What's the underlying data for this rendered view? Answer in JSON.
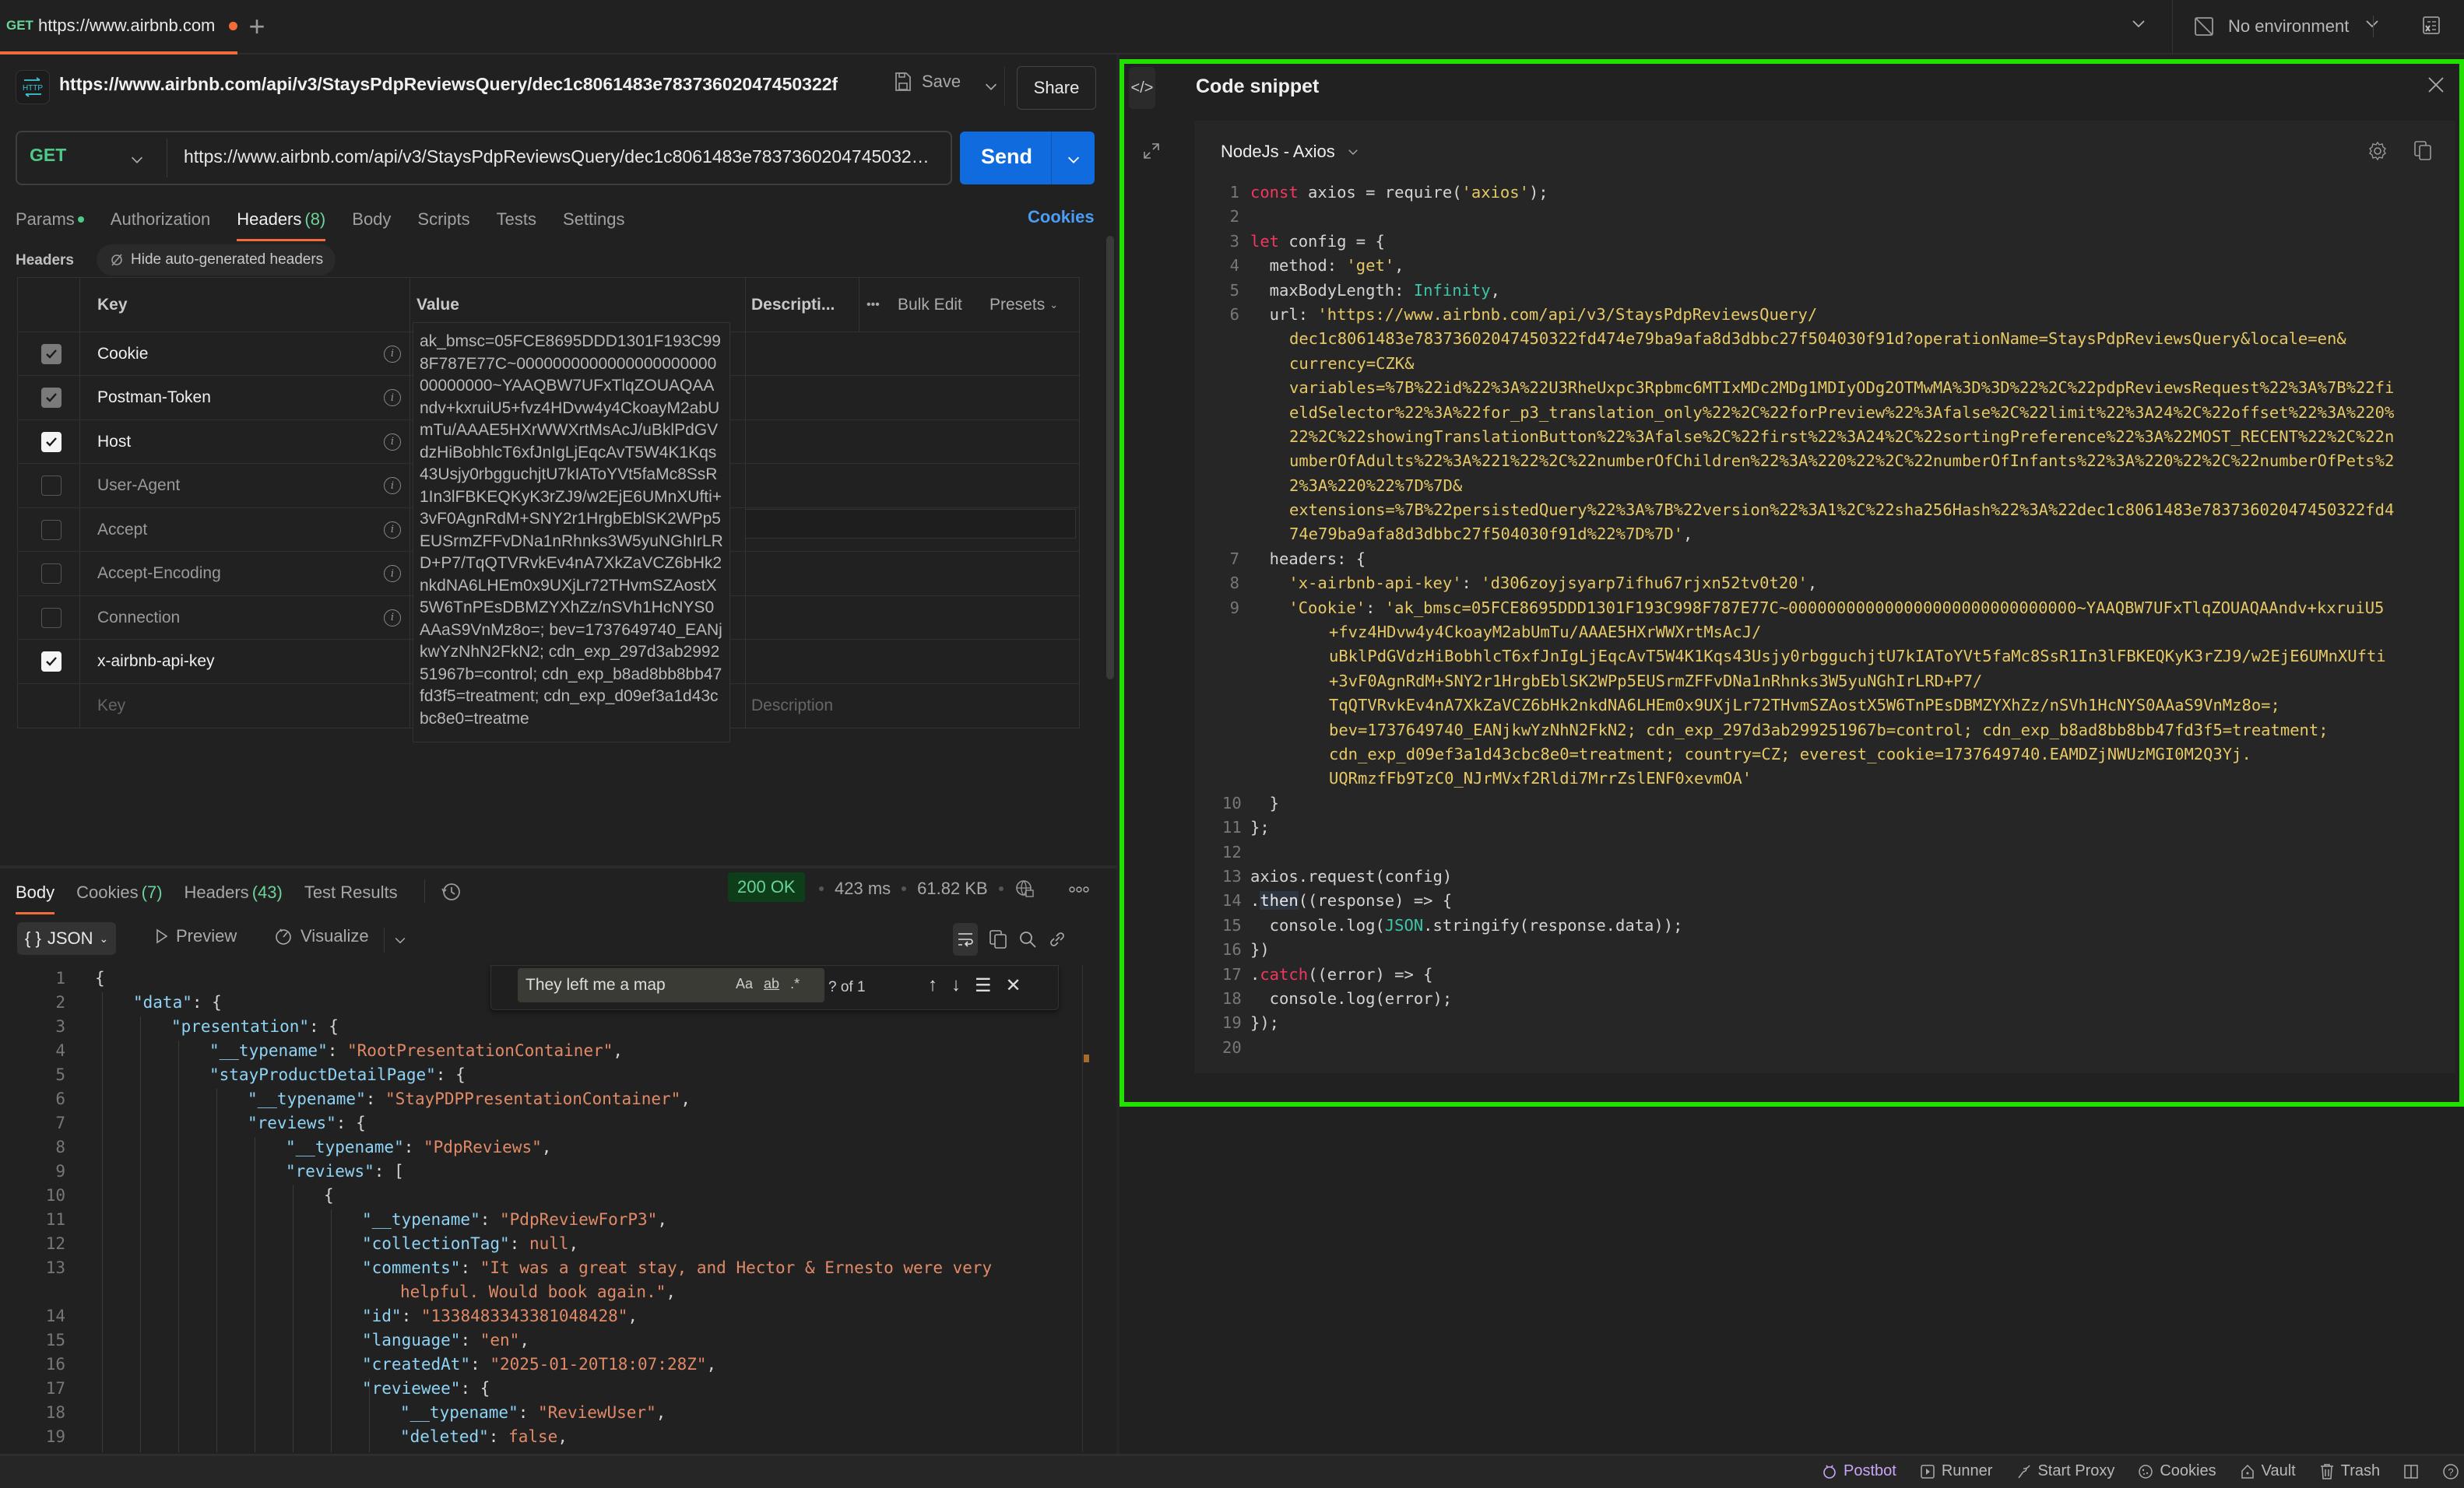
{
  "topbar": {
    "tab": {
      "method": "GET",
      "label": "https://www.airbnb.com",
      "unsaved": true
    },
    "new_tab": "+",
    "environment": "No environment",
    "icons": [
      "plus-icon",
      "chevron-down-icon",
      "no-environment-icon",
      "environment-variables-icon"
    ]
  },
  "request": {
    "title": "https://www.airbnb.com/api/v3/StaysPdpReviewsQuery/dec1c8061483e78373602047450322f...",
    "save_label": "Save",
    "share_label": "Share",
    "method": "GET",
    "url": "https://www.airbnb.com/api/v3/StaysPdpReviewsQuery/dec1c8061483e78373602047450322fd474e79ba9afa8d3dbbc27f504030f91d?operationName=StaysPdpReviewsQuery&locale=en&currency=CZK",
    "send_label": "Send",
    "tabs": [
      {
        "label": "Params",
        "dot": true
      },
      {
        "label": "Authorization"
      },
      {
        "label": "Headers",
        "count": "(8)",
        "active": true
      },
      {
        "label": "Body"
      },
      {
        "label": "Scripts"
      },
      {
        "label": "Tests"
      },
      {
        "label": "Settings"
      }
    ],
    "cookies_link": "Cookies"
  },
  "headers_section": {
    "label": "Headers",
    "hide_auto": "Hide auto-generated headers",
    "columns": {
      "key": "Key",
      "value": "Value",
      "description": "Descripti...",
      "bulk_edit": "Bulk Edit",
      "presets": "Presets"
    },
    "rows": [
      {
        "key": "Cookie",
        "checked": "auto",
        "info": true
      },
      {
        "key": "Postman-Token",
        "checked": "auto",
        "info": true
      },
      {
        "key": "Host",
        "checked": "on",
        "info": true
      },
      {
        "key": "User-Agent",
        "checked": "off",
        "info": true
      },
      {
        "key": "Accept",
        "checked": "off",
        "info": true
      },
      {
        "key": "Accept-Encoding",
        "checked": "off",
        "info": true
      },
      {
        "key": "Connection",
        "checked": "off",
        "info": true
      },
      {
        "key": "x-airbnb-api-key",
        "checked": "on",
        "info": false
      }
    ],
    "new_key_placeholder": "Key",
    "new_desc_placeholder": "Description",
    "cookie_value_expanded": "ak_bmsc=05FCE8695DDD1301F193C998F787E77C~000000000000000000000000000000~YAAQBW7UFxTlqZOUAQAAndv+kxruiU5+fvz4HDvw4y4CkoayM2abUmTu/AAAE5HXrWWXrtMsAcJ/uBklPdGVdzHiBobhlcT6xfJnIgLjEqcAvT5W4K1Kqs43Usjy0rbgguchjtU7kIAToYVt5faMc8SsR1In3lFBKEQKyK3rZJ9/w2EjE6UMnXUfti+3vF0AgnRdM+SNY2r1HrgbEblSK2WPp5EUSrmZFFvDNa1nRhnks3W5yuNGhIrLRD+P7/TqQTVRvkEv4nA7XkZaVCZ6bHk2nkdNA6LHEm0x9UXjLr72THvmSZAostX5W6TnPEsDBMZYXhZz/nSVh1HcNYS0AAaS9VnMz8o=; bev=1737649740_EANjkwYzNhN2FkN2; cdn_exp_297d3ab299251967b=control; cdn_exp_b8ad8bb8bb47fd3f5=treatment; cdn_exp_d09ef3a1d43cbc8e0=treatme"
  },
  "response": {
    "tabs": [
      {
        "label": "Body",
        "active": true
      },
      {
        "label": "Cookies",
        "count": "(7)"
      },
      {
        "label": "Headers",
        "count": "(43)"
      },
      {
        "label": "Test Results"
      }
    ],
    "status": "200 OK",
    "time": "423 ms",
    "size": "61.82 KB",
    "format": "JSON",
    "preview_label": "Preview",
    "visualize_label": "Visualize",
    "find": {
      "query": "They left me a map",
      "count": "? of 1",
      "opts": [
        "Aa",
        "ab",
        ".*"
      ]
    },
    "body_lines": [
      {
        "n": "1",
        "i": 0,
        "parts": [
          [
            "p",
            "{"
          ]
        ]
      },
      {
        "n": "2",
        "i": 1,
        "parts": [
          [
            "k",
            "\"data\""
          ],
          [
            "p",
            ": {"
          ]
        ]
      },
      {
        "n": "3",
        "i": 2,
        "parts": [
          [
            "k",
            "\"presentation\""
          ],
          [
            "p",
            ": {"
          ]
        ]
      },
      {
        "n": "4",
        "i": 3,
        "parts": [
          [
            "k",
            "\"__typename\""
          ],
          [
            "p",
            ": "
          ],
          [
            "s",
            "\"RootPresentationContainer\""
          ],
          [
            "p",
            ","
          ]
        ]
      },
      {
        "n": "5",
        "i": 3,
        "parts": [
          [
            "k",
            "\"stayProductDetailPage\""
          ],
          [
            "p",
            ": {"
          ]
        ]
      },
      {
        "n": "6",
        "i": 4,
        "parts": [
          [
            "k",
            "\"__typename\""
          ],
          [
            "p",
            ": "
          ],
          [
            "s",
            "\"StayPDPPresentationContainer\""
          ],
          [
            "p",
            ","
          ]
        ]
      },
      {
        "n": "7",
        "i": 4,
        "parts": [
          [
            "k",
            "\"reviews\""
          ],
          [
            "p",
            ": {"
          ]
        ]
      },
      {
        "n": "8",
        "i": 5,
        "parts": [
          [
            "k",
            "\"__typename\""
          ],
          [
            "p",
            ": "
          ],
          [
            "s",
            "\"PdpReviews\""
          ],
          [
            "p",
            ","
          ]
        ]
      },
      {
        "n": "9",
        "i": 5,
        "parts": [
          [
            "k",
            "\"reviews\""
          ],
          [
            "p",
            ": ["
          ]
        ]
      },
      {
        "n": "10",
        "i": 6,
        "parts": [
          [
            "p",
            "{"
          ]
        ]
      },
      {
        "n": "11",
        "i": 7,
        "parts": [
          [
            "k",
            "\"__typename\""
          ],
          [
            "p",
            ": "
          ],
          [
            "s",
            "\"PdpReviewForP3\""
          ],
          [
            "p",
            ","
          ]
        ]
      },
      {
        "n": "12",
        "i": 7,
        "parts": [
          [
            "k",
            "\"collectionTag\""
          ],
          [
            "p",
            ": "
          ],
          [
            "n",
            "null"
          ],
          [
            "p",
            ","
          ]
        ]
      },
      {
        "n": "13",
        "i": 7,
        "parts": [
          [
            "k",
            "\"comments\""
          ],
          [
            "p",
            ": "
          ],
          [
            "s",
            "\"It was a great stay, and Hector & Ernesto were very"
          ]
        ]
      },
      {
        "n": "",
        "i": 8,
        "parts": [
          [
            "s",
            "helpful. Would book again.\""
          ],
          [
            "p",
            ","
          ]
        ]
      },
      {
        "n": "14",
        "i": 7,
        "parts": [
          [
            "k",
            "\"id\""
          ],
          [
            "p",
            ": "
          ],
          [
            "s",
            "\"1338483343381048428\""
          ],
          [
            "p",
            ","
          ]
        ]
      },
      {
        "n": "15",
        "i": 7,
        "parts": [
          [
            "k",
            "\"language\""
          ],
          [
            "p",
            ": "
          ],
          [
            "s",
            "\"en\""
          ],
          [
            "p",
            ","
          ]
        ]
      },
      {
        "n": "16",
        "i": 7,
        "parts": [
          [
            "k",
            "\"createdAt\""
          ],
          [
            "p",
            ": "
          ],
          [
            "s",
            "\"2025-01-20T18:07:28Z\""
          ],
          [
            "p",
            ","
          ]
        ]
      },
      {
        "n": "17",
        "i": 7,
        "parts": [
          [
            "k",
            "\"reviewee\""
          ],
          [
            "p",
            ": {"
          ]
        ]
      },
      {
        "n": "18",
        "i": 8,
        "parts": [
          [
            "k",
            "\"__typename\""
          ],
          [
            "p",
            ": "
          ],
          [
            "s",
            "\"ReviewUser\""
          ],
          [
            "p",
            ","
          ]
        ]
      },
      {
        "n": "19",
        "i": 8,
        "parts": [
          [
            "k",
            "\"deleted\""
          ],
          [
            "p",
            ": "
          ],
          [
            "n",
            "false"
          ],
          [
            "p",
            ","
          ]
        ]
      }
    ]
  },
  "code_snippet": {
    "title": "Code snippet",
    "language": "NodeJs - Axios",
    "lines": [
      {
        "n": "1",
        "parts": [
          [
            "kw",
            "const"
          ],
          [
            "p",
            " axios = require("
          ],
          [
            "st",
            "'axios'"
          ],
          [
            "p",
            ");"
          ]
        ]
      },
      {
        "n": "2",
        "parts": []
      },
      {
        "n": "3",
        "parts": [
          [
            "kw",
            "let"
          ],
          [
            "p",
            " config = {"
          ]
        ]
      },
      {
        "n": "4",
        "parts": [
          [
            "p",
            "  method: "
          ],
          [
            "st",
            "'get'"
          ],
          [
            "p",
            ","
          ]
        ]
      },
      {
        "n": "5",
        "parts": [
          [
            "p",
            "  maxBodyLength: "
          ],
          [
            "bi",
            "Infinity"
          ],
          [
            "p",
            ","
          ]
        ]
      },
      {
        "n": "6",
        "parts": [
          [
            "p",
            "  url: "
          ],
          [
            "st",
            "'https://www.airbnb.com/api/v3/StaysPdpReviewsQuery/"
          ]
        ]
      },
      {
        "n": "",
        "c": 1,
        "parts": [
          [
            "st",
            "dec1c8061483e78373602047450322fd474e79ba9afa8d3dbbc27f504030f91d?operationName=StaysPdpReviewsQuery&locale=en&"
          ]
        ]
      },
      {
        "n": "",
        "c": 1,
        "parts": [
          [
            "st",
            "currency=CZK&"
          ]
        ]
      },
      {
        "n": "",
        "c": 1,
        "parts": [
          [
            "st",
            "variables=%7B%22id%22%3A%22U3RheUxpc3Rpbmc6MTIxMDc2MDg1MDIyODg2OTMwMA%3D%3D%22%2C%22pdpReviewsRequest%22%3A%7B%22fi"
          ]
        ]
      },
      {
        "n": "",
        "c": 1,
        "parts": [
          [
            "st",
            "eldSelector%22%3A%22for_p3_translation_only%22%2C%22forPreview%22%3Afalse%2C%22limit%22%3A24%2C%22offset%22%3A%220%"
          ]
        ]
      },
      {
        "n": "",
        "c": 1,
        "parts": [
          [
            "st",
            "22%2C%22showingTranslationButton%22%3Afalse%2C%22first%22%3A24%2C%22sortingPreference%22%3A%22MOST_RECENT%22%2C%22n"
          ]
        ]
      },
      {
        "n": "",
        "c": 1,
        "parts": [
          [
            "st",
            "umberOfAdults%22%3A%221%22%2C%22numberOfChildren%22%3A%220%22%2C%22numberOfInfants%22%3A%220%22%2C%22numberOfPets%2"
          ]
        ]
      },
      {
        "n": "",
        "c": 1,
        "parts": [
          [
            "st",
            "2%3A%220%22%7D%7D&"
          ]
        ]
      },
      {
        "n": "",
        "c": 1,
        "parts": [
          [
            "st",
            "extensions=%7B%22persistedQuery%22%3A%7B%22version%22%3A1%2C%22sha256Hash%22%3A%22dec1c8061483e78373602047450322fd4"
          ]
        ]
      },
      {
        "n": "",
        "c": 1,
        "parts": [
          [
            "st",
            "74e79ba9afa8d3dbbc27f504030f91d%22%7D%7D'"
          ],
          [
            "p",
            ","
          ]
        ]
      },
      {
        "n": "7",
        "parts": [
          [
            "p",
            "  headers: {"
          ]
        ]
      },
      {
        "n": "8",
        "parts": [
          [
            "p",
            "    "
          ],
          [
            "st",
            "'x-airbnb-api-key'"
          ],
          [
            "p",
            ": "
          ],
          [
            "st",
            "'d306zoyjsyarp7ifhu67rjxn52tv0t20'"
          ],
          [
            "p",
            ","
          ]
        ]
      },
      {
        "n": "9",
        "parts": [
          [
            "p",
            "    "
          ],
          [
            "st",
            "'Cookie'"
          ],
          [
            "p",
            ": "
          ],
          [
            "st",
            "'ak_bmsc=05FCE8695DDD1301F193C998F787E77C~000000000000000000000000000000~YAAQBW7UFxTlqZOUAQAAndv+kxruiU5"
          ]
        ]
      },
      {
        "n": "",
        "c": 2,
        "parts": [
          [
            "st",
            "+fvz4HDvw4y4CkoayM2abUmTu/AAAE5HXrWWXrtMsAcJ/"
          ]
        ]
      },
      {
        "n": "",
        "c": 2,
        "parts": [
          [
            "st",
            "uBklPdGVdzHiBobhlcT6xfJnIgLjEqcAvT5W4K1Kqs43Usjy0rbgguchjtU7kIAToYVt5faMc8SsR1In3lFBKEQKyK3rZJ9/w2EjE6UMnXUfti"
          ]
        ]
      },
      {
        "n": "",
        "c": 2,
        "parts": [
          [
            "st",
            "+3vF0AgnRdM+SNY2r1HrgbEblSK2WPp5EUSrmZFFvDNa1nRhnks3W5yuNGhIrLRD+P7/"
          ]
        ]
      },
      {
        "n": "",
        "c": 2,
        "parts": [
          [
            "st",
            "TqQTVRvkEv4nA7XkZaVCZ6bHk2nkdNA6LHEm0x9UXjLr72THvmSZAostX5W6TnPEsDBMZYXhZz/nSVh1HcNYS0AAaS9VnMz8o=;"
          ]
        ]
      },
      {
        "n": "",
        "c": 2,
        "parts": [
          [
            "st",
            "bev=1737649740_EANjkwYzNhN2FkN2; cdn_exp_297d3ab299251967b=control; cdn_exp_b8ad8bb8bb47fd3f5=treatment;"
          ]
        ]
      },
      {
        "n": "",
        "c": 2,
        "parts": [
          [
            "st",
            "cdn_exp_d09ef3a1d43cbc8e0=treatment; country=CZ; everest_cookie=1737649740.EAMDZjNWUzMGI0M2Q3Yj."
          ]
        ]
      },
      {
        "n": "",
        "c": 2,
        "parts": [
          [
            "st",
            "UQRmzfFb9TzC0_NJrMVxf2Rldi7MrrZslENF0xevmOA'"
          ]
        ]
      },
      {
        "n": "10",
        "parts": [
          [
            "p",
            "  }"
          ]
        ]
      },
      {
        "n": "11",
        "parts": [
          [
            "p",
            "};"
          ]
        ]
      },
      {
        "n": "12",
        "parts": []
      },
      {
        "n": "13",
        "parts": [
          [
            "p",
            "axios.request(config)"
          ]
        ]
      },
      {
        "n": "14",
        "parts": [
          [
            "p",
            "."
          ],
          [
            "hl",
            "then"
          ],
          [
            "p",
            "((response) => {"
          ]
        ]
      },
      {
        "n": "15",
        "parts": [
          [
            "p",
            "  console.log("
          ],
          [
            "bi",
            "JSON"
          ],
          [
            "p",
            ".stringify(response.data));"
          ]
        ]
      },
      {
        "n": "16",
        "parts": [
          [
            "p",
            "})"
          ]
        ]
      },
      {
        "n": "17",
        "parts": [
          [
            "p",
            "."
          ],
          [
            "kw",
            "catch"
          ],
          [
            "p",
            "((error) => {"
          ]
        ]
      },
      {
        "n": "18",
        "parts": [
          [
            "p",
            "  console.log(error);"
          ]
        ]
      },
      {
        "n": "19",
        "parts": [
          [
            "p",
            "});"
          ]
        ]
      },
      {
        "n": "20",
        "parts": []
      }
    ]
  },
  "statusbar": {
    "items": [
      {
        "label": "Postbot",
        "icon": "postbot-icon"
      },
      {
        "label": "Runner",
        "icon": "runner-icon"
      },
      {
        "label": "Start Proxy",
        "icon": "proxy-icon"
      },
      {
        "label": "Cookies",
        "icon": "cookie-icon"
      },
      {
        "label": "Vault",
        "icon": "vault-icon"
      },
      {
        "label": "Trash",
        "icon": "trash-icon"
      }
    ]
  },
  "colors": {
    "accent": "#f26b3a",
    "send": "#0f6bde",
    "highlight_frame": "#22e000",
    "status_ok": "#6bd49a"
  }
}
